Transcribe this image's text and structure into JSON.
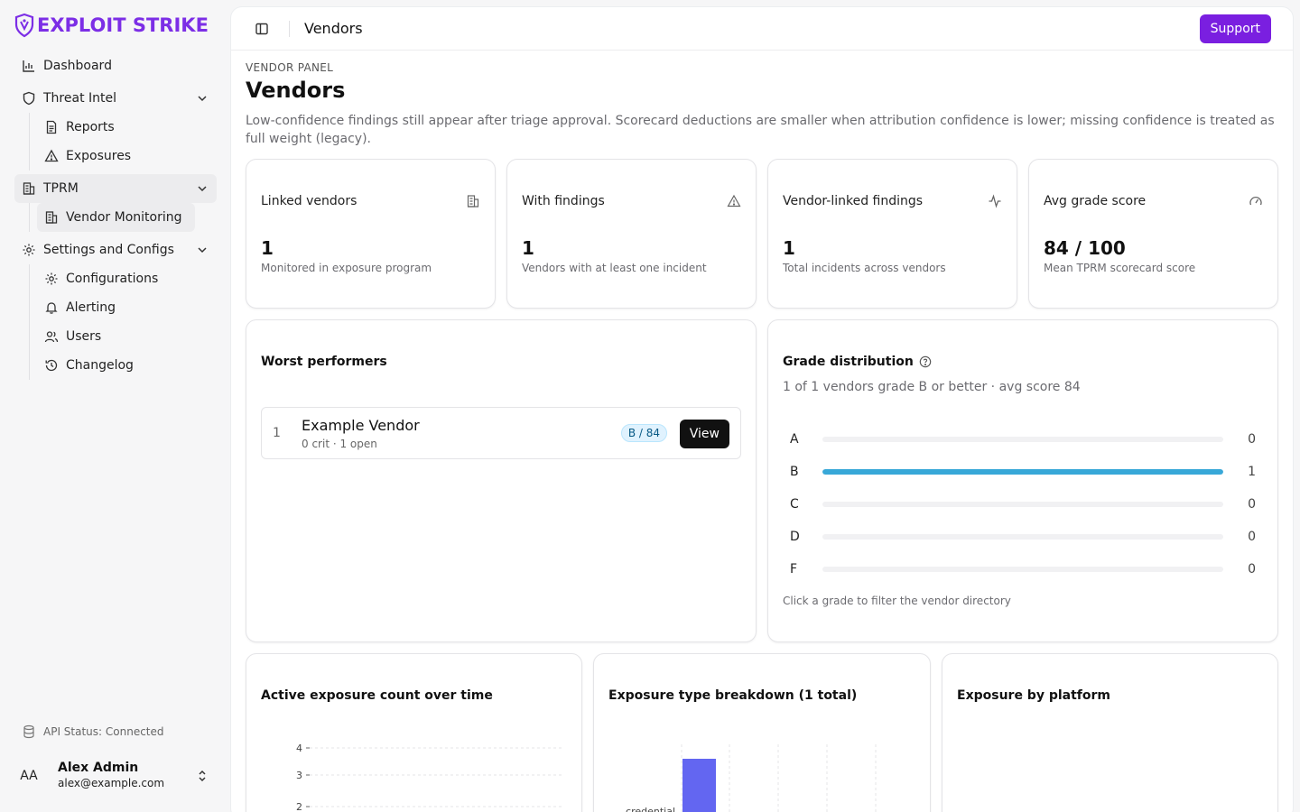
{
  "brand": {
    "name": "EXPLOIT STRIKE",
    "color": "#7c2ee6"
  },
  "sidebar": {
    "items": [
      {
        "label": "Dashboard",
        "icon": "bar-chart-icon"
      },
      {
        "label": "Threat Intel",
        "icon": "shield-icon",
        "children": [
          {
            "label": "Reports",
            "icon": "file-text-icon"
          },
          {
            "label": "Exposures",
            "icon": "alert-triangle-icon"
          }
        ]
      },
      {
        "label": "TPRM",
        "icon": "building-icon",
        "children": [
          {
            "label": "Vendor Monitoring",
            "icon": "building-icon"
          }
        ]
      },
      {
        "label": "Settings and Configs",
        "icon": "gear-icon",
        "children": [
          {
            "label": "Configurations",
            "icon": "gear-icon"
          },
          {
            "label": "Alerting",
            "icon": "bell-icon"
          },
          {
            "label": "Users",
            "icon": "users-icon"
          },
          {
            "label": "Changelog",
            "icon": "history-icon"
          }
        ]
      }
    ],
    "api_status": "API Status: Connected",
    "user": {
      "initials": "AA",
      "name": "Alex Admin",
      "email": "alex@example.com"
    }
  },
  "topbar": {
    "title": "Vendors",
    "support_label": "Support"
  },
  "page": {
    "eyebrow": "VENDOR PANEL",
    "title": "Vendors",
    "description": "Low-confidence findings still appear after triage approval. Scorecard deductions are smaller when attribution confidence is lower; missing confidence is treated as full weight (legacy)."
  },
  "stats": [
    {
      "title": "Linked vendors",
      "value": "1",
      "sub": "Monitored in exposure program",
      "icon": "building-icon"
    },
    {
      "title": "With findings",
      "value": "1",
      "sub": "Vendors with at least one incident",
      "icon": "alert-triangle-icon"
    },
    {
      "title": "Vendor-linked findings",
      "value": "1",
      "sub": "Total incidents across vendors",
      "icon": "activity-icon"
    },
    {
      "title": "Avg grade score",
      "value": "84 / 100",
      "sub": "Mean TPRM scorecard score",
      "icon": "gauge-icon"
    }
  ],
  "worst": {
    "title": "Worst performers",
    "rows": [
      {
        "rank": "1",
        "name": "Example Vendor",
        "meta": "0 crit · 1 open",
        "badge": "B / 84",
        "action": "View"
      }
    ]
  },
  "grades": {
    "title": "Grade distribution",
    "subtitle": "1 of 1 vendors grade B or better · avg score 84",
    "hint": "Click a grade to filter the vendor directory",
    "rows": [
      {
        "letter": "A",
        "count": "0",
        "fraction": 0
      },
      {
        "letter": "B",
        "count": "1",
        "fraction": 1
      },
      {
        "letter": "C",
        "count": "0",
        "fraction": 0
      },
      {
        "letter": "D",
        "count": "0",
        "fraction": 0
      },
      {
        "letter": "F",
        "count": "0",
        "fraction": 0
      }
    ],
    "fill_color": "#38a8d8"
  },
  "bottom_cards": {
    "active_title": "Active exposure count over time",
    "type_title": "Exposure type breakdown (1 total)",
    "platform_title": "Exposure by platform"
  },
  "chart_data": [
    {
      "type": "line",
      "title": "Active exposure count over time",
      "y_ticks": [
        "4",
        "3",
        "2"
      ],
      "grid": true
    },
    {
      "type": "bar",
      "title": "Exposure type breakdown (1 total)",
      "categories": [
        "credential"
      ],
      "values": [
        1
      ],
      "color": "#6366f1",
      "grid": true
    }
  ]
}
